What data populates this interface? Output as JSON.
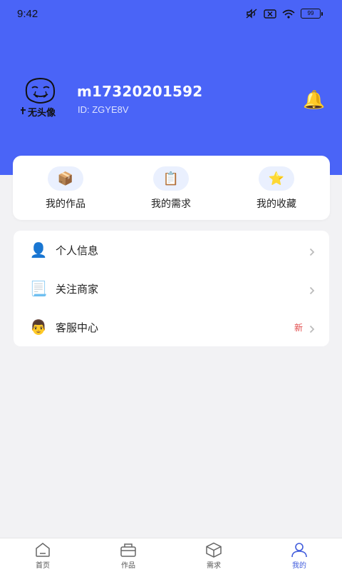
{
  "status_bar": {
    "time": "9:42",
    "battery": "99",
    "icons": [
      "mute-icon",
      "no-sim-icon",
      "wifi-icon",
      "battery-icon"
    ]
  },
  "profile": {
    "username": "m17320201592",
    "user_id": "ID: ZGYE8V",
    "avatar_text": "无头像",
    "header_color": "#4a64f7"
  },
  "quick_actions": [
    {
      "label": "我的作品",
      "icon": "package-icon"
    },
    {
      "label": "我的需求",
      "icon": "clipboard-icon"
    },
    {
      "label": "我的收藏",
      "icon": "star-icon"
    }
  ],
  "menu": [
    {
      "label": "个人信息",
      "icon": "person-icon",
      "badge": ""
    },
    {
      "label": "关注商家",
      "icon": "notepad-icon",
      "badge": ""
    },
    {
      "label": "客服中心",
      "icon": "support-agent-icon",
      "badge": "新"
    }
  ],
  "tabs": [
    {
      "label": "首页",
      "icon": "home-icon",
      "active": false
    },
    {
      "label": "作品",
      "icon": "works-icon",
      "active": false
    },
    {
      "label": "需求",
      "icon": "box-icon",
      "active": false
    },
    {
      "label": "我的",
      "icon": "profile-icon",
      "active": true
    }
  ],
  "colors": {
    "primary": "#4a64f7",
    "tab_active": "#3f5bdc",
    "badge": "#e24c4c",
    "background": "#f2f2f4"
  }
}
